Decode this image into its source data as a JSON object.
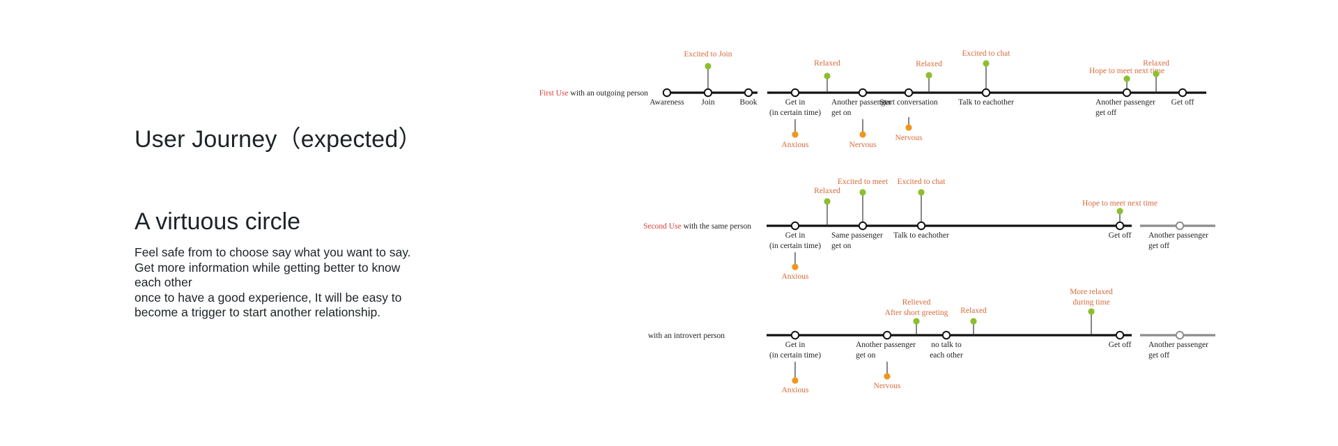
{
  "heading": {
    "title": "User Journey（expected）",
    "subtitle": "A virtuous circle",
    "body_lines": [
      "Feel safe from to choose say what you want to say.",
      "Get more information while getting better to know",
      "each other",
      "once to have a good experience, It will be easy to",
      "become a trigger to start another relationship."
    ]
  },
  "colors": {
    "positive_dot": "#8cbf2f",
    "negative_dot": "#f0961e",
    "emotion_text": "#d9693a",
    "row_label_accent": "#d9403a",
    "line_main": "#111111",
    "line_muted": "#8c8c8c",
    "text": "#222222"
  },
  "journeys": [
    {
      "id": "first-use",
      "label_accent": "First Use",
      "label_rest": " with an outgoing person",
      "steps": [
        {
          "id": "awareness",
          "label": [
            "Awareness"
          ]
        },
        {
          "id": "join",
          "label": [
            "Join"
          ]
        },
        {
          "id": "book",
          "label": [
            "Book"
          ]
        },
        {
          "id": "get-in",
          "label": [
            "Get in",
            "(in certain time)"
          ]
        },
        {
          "id": "another-passenger-on",
          "label": [
            "Another passenger",
            "get on"
          ]
        },
        {
          "id": "start-conversation",
          "label": [
            "Start conversation"
          ]
        },
        {
          "id": "talk",
          "label": [
            "Talk to eachother"
          ]
        },
        {
          "id": "another-passenger-off",
          "label": [
            "Another passenger",
            "get off"
          ]
        },
        {
          "id": "get-off",
          "label": [
            "Get off"
          ]
        }
      ],
      "emotions": [
        {
          "label": [
            "Excited to Join"
          ],
          "polarity": "positive",
          "at": "join"
        },
        {
          "label": [
            "Relaxed"
          ],
          "polarity": "positive",
          "at": "relaxed-1"
        },
        {
          "label": [
            "Relaxed"
          ],
          "polarity": "positive",
          "at": "relaxed-2"
        },
        {
          "label": [
            "Excited to chat"
          ],
          "polarity": "positive",
          "at": "talk"
        },
        {
          "label": [
            "Hope to meet next time"
          ],
          "polarity": "positive",
          "at": "another-passenger-off"
        },
        {
          "label": [
            "Relaxed"
          ],
          "polarity": "positive",
          "at": "relaxed-3"
        },
        {
          "label": [
            "Anxious"
          ],
          "polarity": "negative",
          "at": "get-in"
        },
        {
          "label": [
            "Nervous"
          ],
          "polarity": "negative",
          "at": "another-passenger-on"
        },
        {
          "label": [
            "Nervous"
          ],
          "polarity": "negative",
          "at": "start-conversation"
        }
      ]
    },
    {
      "id": "second-use",
      "label_accent": "Second Use",
      "label_rest": " with the same person",
      "steps": [
        {
          "id": "get-in",
          "label": [
            "Get in",
            "(in certain time)"
          ]
        },
        {
          "id": "same-passenger-on",
          "label": [
            "Same passenger",
            "get on"
          ]
        },
        {
          "id": "talk",
          "label": [
            "Talk to eachother"
          ]
        },
        {
          "id": "get-off",
          "label": [
            "Get off"
          ]
        },
        {
          "id": "another-passenger-off",
          "label": [
            "Another passenger",
            "get off"
          ],
          "muted": true
        }
      ],
      "emotions": [
        {
          "label": [
            "Relaxed"
          ],
          "polarity": "positive",
          "at": "relaxed-1"
        },
        {
          "label": [
            "Excited to meet"
          ],
          "polarity": "positive",
          "at": "same-passenger-on"
        },
        {
          "label": [
            "Excited to chat"
          ],
          "polarity": "positive",
          "at": "talk"
        },
        {
          "label": [
            "Hope to meet next time"
          ],
          "polarity": "positive",
          "at": "get-off"
        },
        {
          "label": [
            "Anxious"
          ],
          "polarity": "negative",
          "at": "get-in"
        }
      ]
    },
    {
      "id": "introvert",
      "label_accent": "",
      "label_rest": "with an introvert person",
      "steps": [
        {
          "id": "get-in",
          "label": [
            "Get in",
            "(in certain time)"
          ]
        },
        {
          "id": "another-passenger-on",
          "label": [
            "Another passenger",
            "get on"
          ]
        },
        {
          "id": "no-talk",
          "label": [
            "no talk to",
            "each other"
          ]
        },
        {
          "id": "get-off",
          "label": [
            "Get off"
          ]
        },
        {
          "id": "another-passenger-off",
          "label": [
            "Another passenger",
            "get off"
          ],
          "muted": true
        }
      ],
      "emotions": [
        {
          "label": [
            "Relieved",
            "After short greeting"
          ],
          "polarity": "positive",
          "at": "relieved"
        },
        {
          "label": [
            "Relaxed"
          ],
          "polarity": "positive",
          "at": "relaxed-1"
        },
        {
          "label": [
            "More relaxed",
            "during time"
          ],
          "polarity": "positive",
          "at": "more-relaxed"
        },
        {
          "label": [
            "Anxious"
          ],
          "polarity": "negative",
          "at": "get-in"
        },
        {
          "label": [
            "Nervous"
          ],
          "polarity": "negative",
          "at": "another-passenger-on"
        }
      ]
    }
  ]
}
